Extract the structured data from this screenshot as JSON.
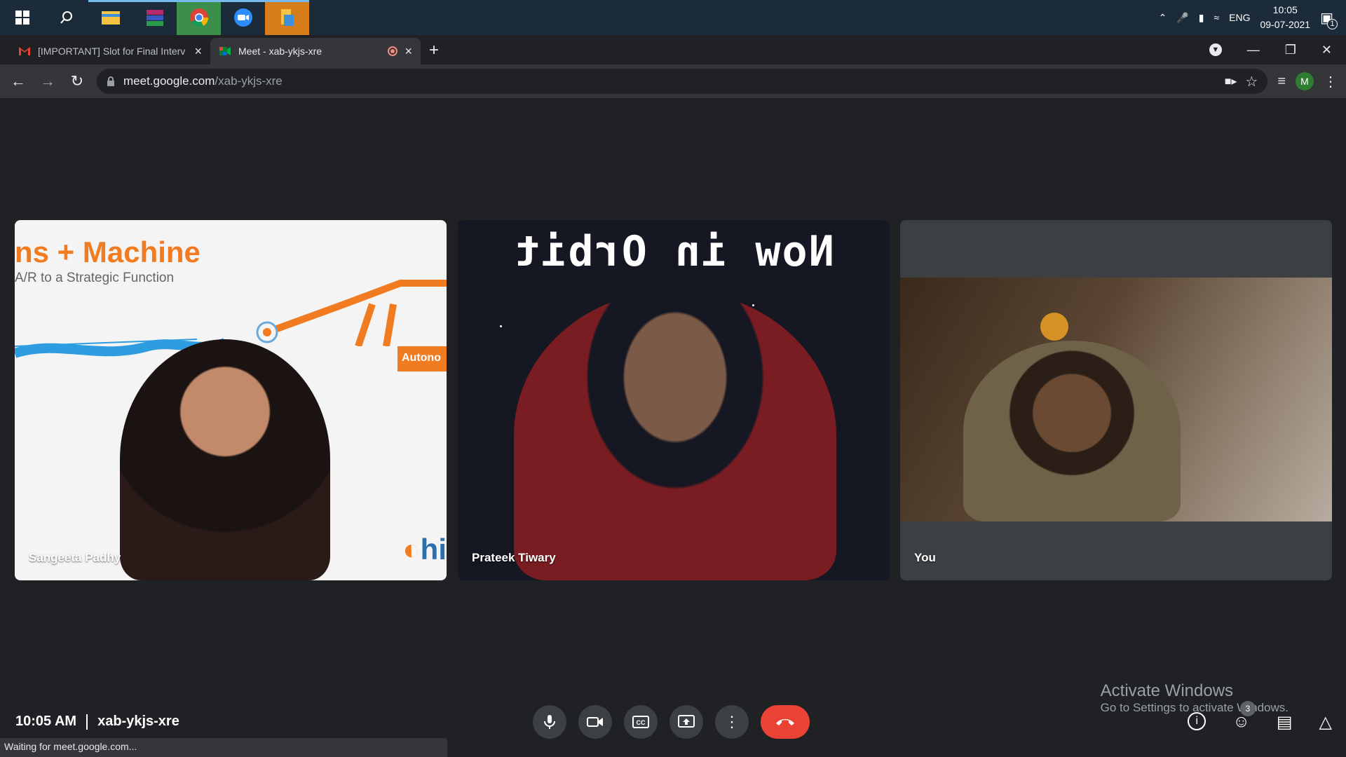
{
  "taskbar": {
    "tray": {
      "lang": "ENG",
      "time": "10:05",
      "date": "09-07-2021",
      "notif_count": "1"
    }
  },
  "tabs": [
    {
      "title": "[IMPORTANT] Slot for Final Interv"
    },
    {
      "title": "Meet - xab-ykjs-xre"
    }
  ],
  "address": {
    "host": "meet.google.com",
    "path": "/xab-ykjs-xre"
  },
  "profile": {
    "initial": "M"
  },
  "participants": [
    {
      "name": "Sangeeta Padhy"
    },
    {
      "name": "Prateek Tiwary"
    },
    {
      "name": "You"
    }
  ],
  "slide": {
    "title": "ns + Machine",
    "subtitle": "A/R to a Strategic Function",
    "tag": "Autono",
    "logo_text": "hi"
  },
  "background_text": "Now in Orbit",
  "meeting": {
    "time": "10:05 AM",
    "code": "xab-ykjs-xre",
    "people_count": "3"
  },
  "watermark": {
    "title": "Activate Windows",
    "subtitle": "Go to Settings to activate Windows."
  },
  "status": "Waiting for meet.google.com..."
}
